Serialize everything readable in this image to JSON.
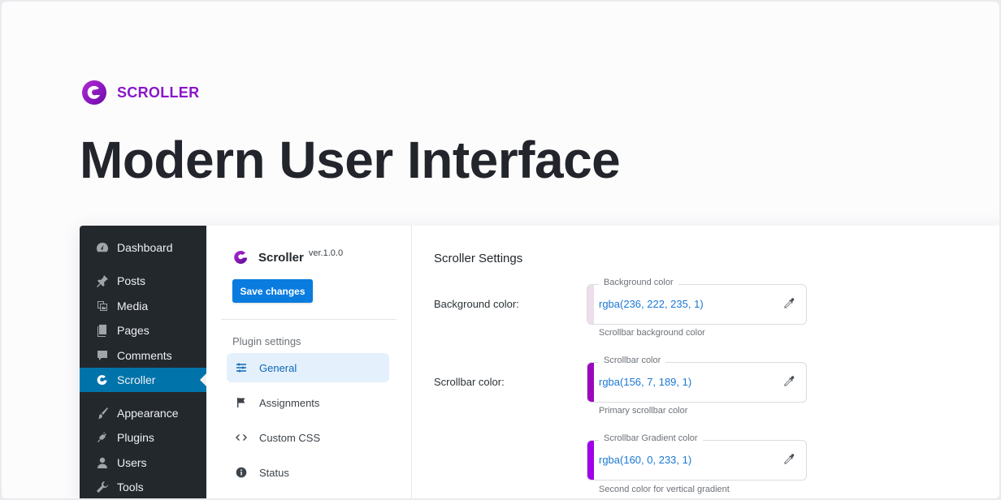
{
  "brand": {
    "name": "SCROLLER",
    "accent": "#8a16c9"
  },
  "hero": {
    "title": "Modern User Interface"
  },
  "wp_menu": {
    "items": [
      {
        "label": "Dashboard",
        "icon": "dashboard-icon"
      },
      {
        "label": "Posts",
        "icon": "pin-icon"
      },
      {
        "label": "Media",
        "icon": "media-icon"
      },
      {
        "label": "Pages",
        "icon": "pages-icon"
      },
      {
        "label": "Comments",
        "icon": "comment-icon"
      },
      {
        "label": "Scroller",
        "icon": "scroller-icon",
        "active": true
      },
      {
        "label": "Appearance",
        "icon": "brush-icon"
      },
      {
        "label": "Plugins",
        "icon": "plug-icon"
      },
      {
        "label": "Users",
        "icon": "user-icon"
      },
      {
        "label": "Tools",
        "icon": "wrench-icon"
      }
    ],
    "active_color": "#0073aa"
  },
  "plugin": {
    "name": "Scroller",
    "version": "ver.1.0.0",
    "save_label": "Save changes",
    "section_label": "Plugin settings",
    "nav": [
      {
        "label": "General",
        "icon": "sliders-icon",
        "active": true
      },
      {
        "label": "Assignments",
        "icon": "flag-icon"
      },
      {
        "label": "Custom CSS",
        "icon": "code-icon"
      },
      {
        "label": "Status",
        "icon": "info-icon"
      }
    ]
  },
  "settings": {
    "title": "Scroller Settings",
    "fields": [
      {
        "row_label": "Background color:",
        "field_label": "Background color",
        "value": "rgba(236, 222, 235, 1)",
        "help": "Scrollbar background color",
        "swatch": "#ecdeeb"
      },
      {
        "row_label": "Scrollbar color:",
        "field_label": "Scrollbar color",
        "value": "rgba(156, 7, 189, 1)",
        "help": "Primary scrollbar color",
        "swatch": "#9c07bd"
      },
      {
        "row_label": "",
        "field_label": "Scrollbar Gradient color",
        "value": "rgba(160, 0, 233, 1)",
        "help": "Second color for vertical gradient",
        "swatch": "#a000e9"
      }
    ]
  }
}
